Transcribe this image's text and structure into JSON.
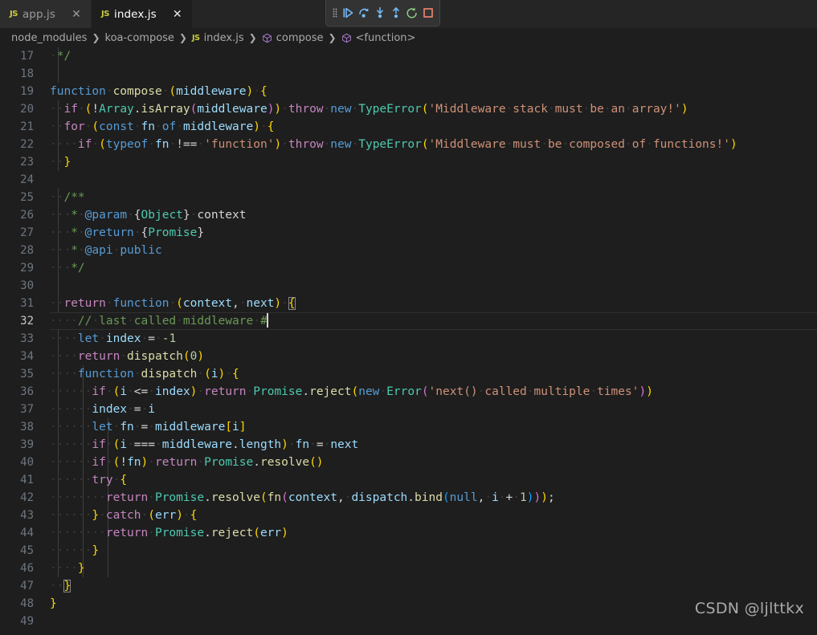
{
  "window": {
    "theme_background": "#1e1e1e",
    "tabbar_background": "#252526"
  },
  "tabs": [
    {
      "label": "app.js",
      "icon": "js-file-icon",
      "icon_text": "JS",
      "active": false,
      "close_glyph": "✕"
    },
    {
      "label": "index.js",
      "icon": "js-file-icon",
      "icon_text": "JS",
      "active": true,
      "close_glyph": "✕"
    }
  ],
  "debug_toolbar": {
    "grip": "drag-handle-icon",
    "buttons": [
      {
        "name": "continue-button",
        "tooltip": "Continue",
        "color": "#75beff"
      },
      {
        "name": "step-over-button",
        "tooltip": "Step Over",
        "color": "#75beff"
      },
      {
        "name": "step-into-button",
        "tooltip": "Step Into",
        "color": "#75beff"
      },
      {
        "name": "step-out-button",
        "tooltip": "Step Out",
        "color": "#75beff"
      },
      {
        "name": "restart-button",
        "tooltip": "Restart",
        "color": "#89d185"
      },
      {
        "name": "stop-button",
        "tooltip": "Stop",
        "color": "#f48771"
      }
    ]
  },
  "breadcrumb": {
    "separator": "❯",
    "items": [
      {
        "label": "node_modules",
        "icon": "none"
      },
      {
        "label": "koa-compose",
        "icon": "none"
      },
      {
        "label": "index.js",
        "icon": "js-file-icon",
        "icon_text": "JS"
      },
      {
        "label": "compose",
        "icon": "symbol-function-icon"
      },
      {
        "label": "<function>",
        "icon": "symbol-function-icon"
      }
    ]
  },
  "editor": {
    "active_line_number": 32,
    "cursor_line": 32,
    "first_line_number": 17,
    "last_line_number": 49,
    "lines": [
      {
        "n": 17,
        "text": " */"
      },
      {
        "n": 18,
        "text": ""
      },
      {
        "n": 19,
        "text": "function compose (middleware) {"
      },
      {
        "n": 20,
        "text": "  if (!Array.isArray(middleware)) throw new TypeError('Middleware stack must be an array!')"
      },
      {
        "n": 21,
        "text": "  for (const fn of middleware) {"
      },
      {
        "n": 22,
        "text": "    if (typeof fn !== 'function') throw new TypeError('Middleware must be composed of functions!')"
      },
      {
        "n": 23,
        "text": "  }"
      },
      {
        "n": 24,
        "text": ""
      },
      {
        "n": 25,
        "text": "  /**"
      },
      {
        "n": 26,
        "text": "   * @param {Object} context"
      },
      {
        "n": 27,
        "text": "   * @return {Promise}"
      },
      {
        "n": 28,
        "text": "   * @api public"
      },
      {
        "n": 29,
        "text": "   */"
      },
      {
        "n": 30,
        "text": ""
      },
      {
        "n": 31,
        "text": "  return function (context, next) {"
      },
      {
        "n": 32,
        "text": "    // last called middleware #"
      },
      {
        "n": 33,
        "text": "    let index = -1"
      },
      {
        "n": 34,
        "text": "    return dispatch(0)"
      },
      {
        "n": 35,
        "text": "    function dispatch (i) {"
      },
      {
        "n": 36,
        "text": "      if (i <= index) return Promise.reject(new Error('next() called multiple times'))"
      },
      {
        "n": 37,
        "text": "      index = i"
      },
      {
        "n": 38,
        "text": "      let fn = middleware[i]"
      },
      {
        "n": 39,
        "text": "      if (i === middleware.length) fn = next"
      },
      {
        "n": 40,
        "text": "      if (!fn) return Promise.resolve()"
      },
      {
        "n": 41,
        "text": "      try {"
      },
      {
        "n": 42,
        "text": "        return Promise.resolve(fn(context, dispatch.bind(null, i + 1)));"
      },
      {
        "n": 43,
        "text": "      } catch (err) {"
      },
      {
        "n": 44,
        "text": "        return Promise.reject(err)"
      },
      {
        "n": 45,
        "text": "      }"
      },
      {
        "n": 46,
        "text": "    }"
      },
      {
        "n": 47,
        "text": "  }"
      },
      {
        "n": 48,
        "text": "}"
      },
      {
        "n": 49,
        "text": ""
      }
    ]
  },
  "watermark": {
    "text": "CSDN @ljlttkx"
  }
}
